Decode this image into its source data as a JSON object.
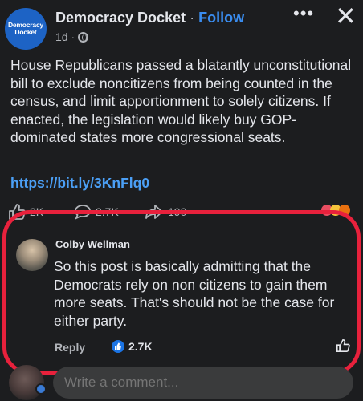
{
  "post": {
    "page_logo_text": [
      "Democracy",
      "Docket"
    ],
    "page_name": "Democracy Docket",
    "separator": "·",
    "follow_label": "Follow",
    "age": "1d ·",
    "more_icon": "more-horizontal-icon",
    "close_icon": "close-icon",
    "text": "House Republicans passed a blatantly unconstitutional bill to exclude noncitizens from being counted in the census, and limit apportionment to solely citizens. If enacted, the legislation would likely buy GOP-dominated states more congressional seats.",
    "link": "https://bit.ly/3KnFlq0",
    "stats": {
      "likes": "2K",
      "comments": "2.7K",
      "shares": "190"
    }
  },
  "comment": {
    "author": "Colby Wellman",
    "text": "So this post is basically admitting that the Democrats rely on non citizens to gain them more seats. That's should not be the case for either party.",
    "reply_label": "Reply",
    "likes": "2.7K"
  },
  "composer": {
    "placeholder": "Write a comment..."
  },
  "colors": {
    "background": "#1c1d1f",
    "text": "#e4e6eb",
    "link": "#4b9ff5",
    "highlight": "#e8213c",
    "like_blue": "#1b74e4"
  }
}
